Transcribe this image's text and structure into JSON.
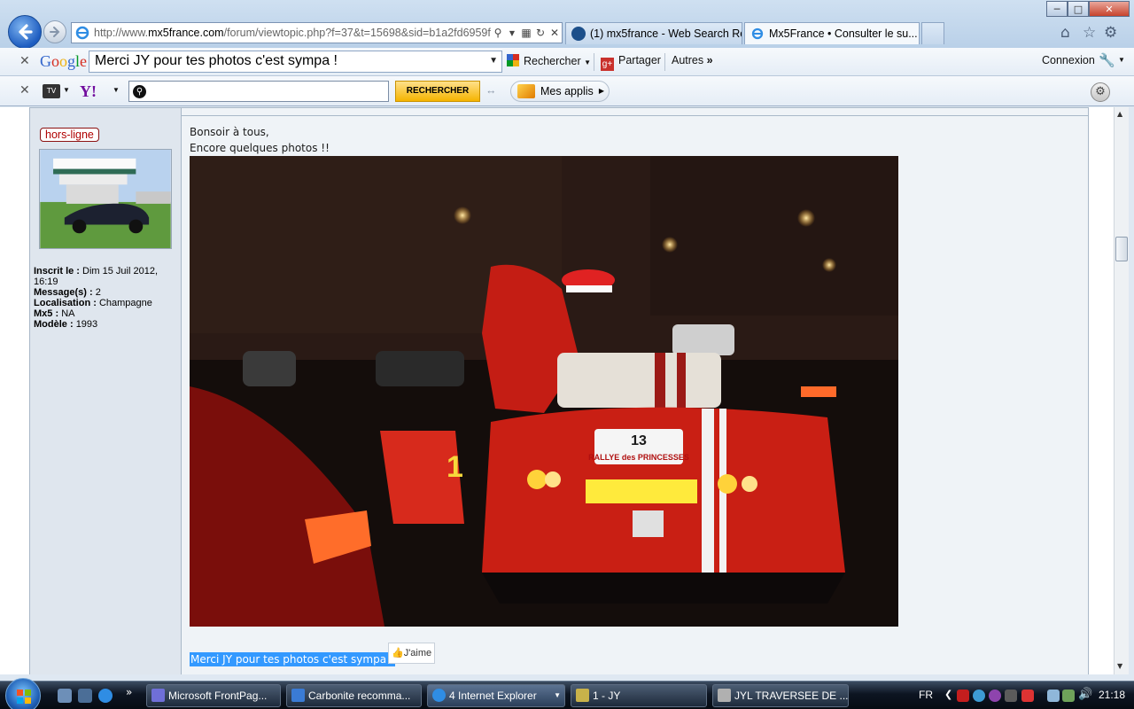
{
  "browser": {
    "address_prefix": "http://www.",
    "address_host": "mx5france.com",
    "address_path": "/forum/viewtopic.php?f=37&t=15698&sid=b1a2fd6959f",
    "tabs": [
      {
        "label": "(1) mx5france - Web Search Re..."
      },
      {
        "label": "Mx5France • Consulter le su..."
      }
    ],
    "colors": {
      "accent": "#1d5cc0",
      "tab_active": "#f4f8fc"
    }
  },
  "google_toolbar": {
    "logo": "Google",
    "search_value": "Merci JY pour tes photos c'est sympa !",
    "search_label": "Rechercher",
    "share_label": "Partager",
    "more_label": "Autres",
    "signin_label": "Connexion"
  },
  "yahoo_toolbar": {
    "logo": "Y!",
    "tv_label": "TV",
    "search_value": "",
    "search_button": "RECHERCHER",
    "apps_label": "Mes applis"
  },
  "post": {
    "status": "hors-ligne",
    "profile": [
      {
        "label": "Inscrit le :",
        "value": "Dim 15 Juil 2012, 16:19"
      },
      {
        "label": "Message(s) :",
        "value": "2"
      },
      {
        "label": "Localisation :",
        "value": "Champagne"
      },
      {
        "label": "Mx5 :",
        "value": "NA"
      },
      {
        "label": "Modèle :",
        "value": "1993"
      }
    ],
    "lines": [
      "Bonsoir à tous,",
      "Encore quelques photos !!"
    ],
    "photo_plate_number": "13",
    "photo_plate_text": "RALLYE des PRINCESSES",
    "photo_door_number": "1",
    "selected_text": "Merci JY pour tes photos c'est sympa !",
    "like_label": "J'aime"
  },
  "taskbar": {
    "tasks": [
      {
        "label": "Microsoft FrontPag...",
        "color": "#6f6fd8"
      },
      {
        "label": "Carbonite recomma...",
        "color": "#3a7bd5"
      },
      {
        "label": "4 Internet Explorer",
        "color": "#2f8de4"
      },
      {
        "label": "1 - JY",
        "color": "#c8b24a"
      },
      {
        "label": "JYL   TRAVERSEE DE ...",
        "color": "#b0b0b0"
      }
    ],
    "lang": "FR",
    "clock": "21:18"
  }
}
